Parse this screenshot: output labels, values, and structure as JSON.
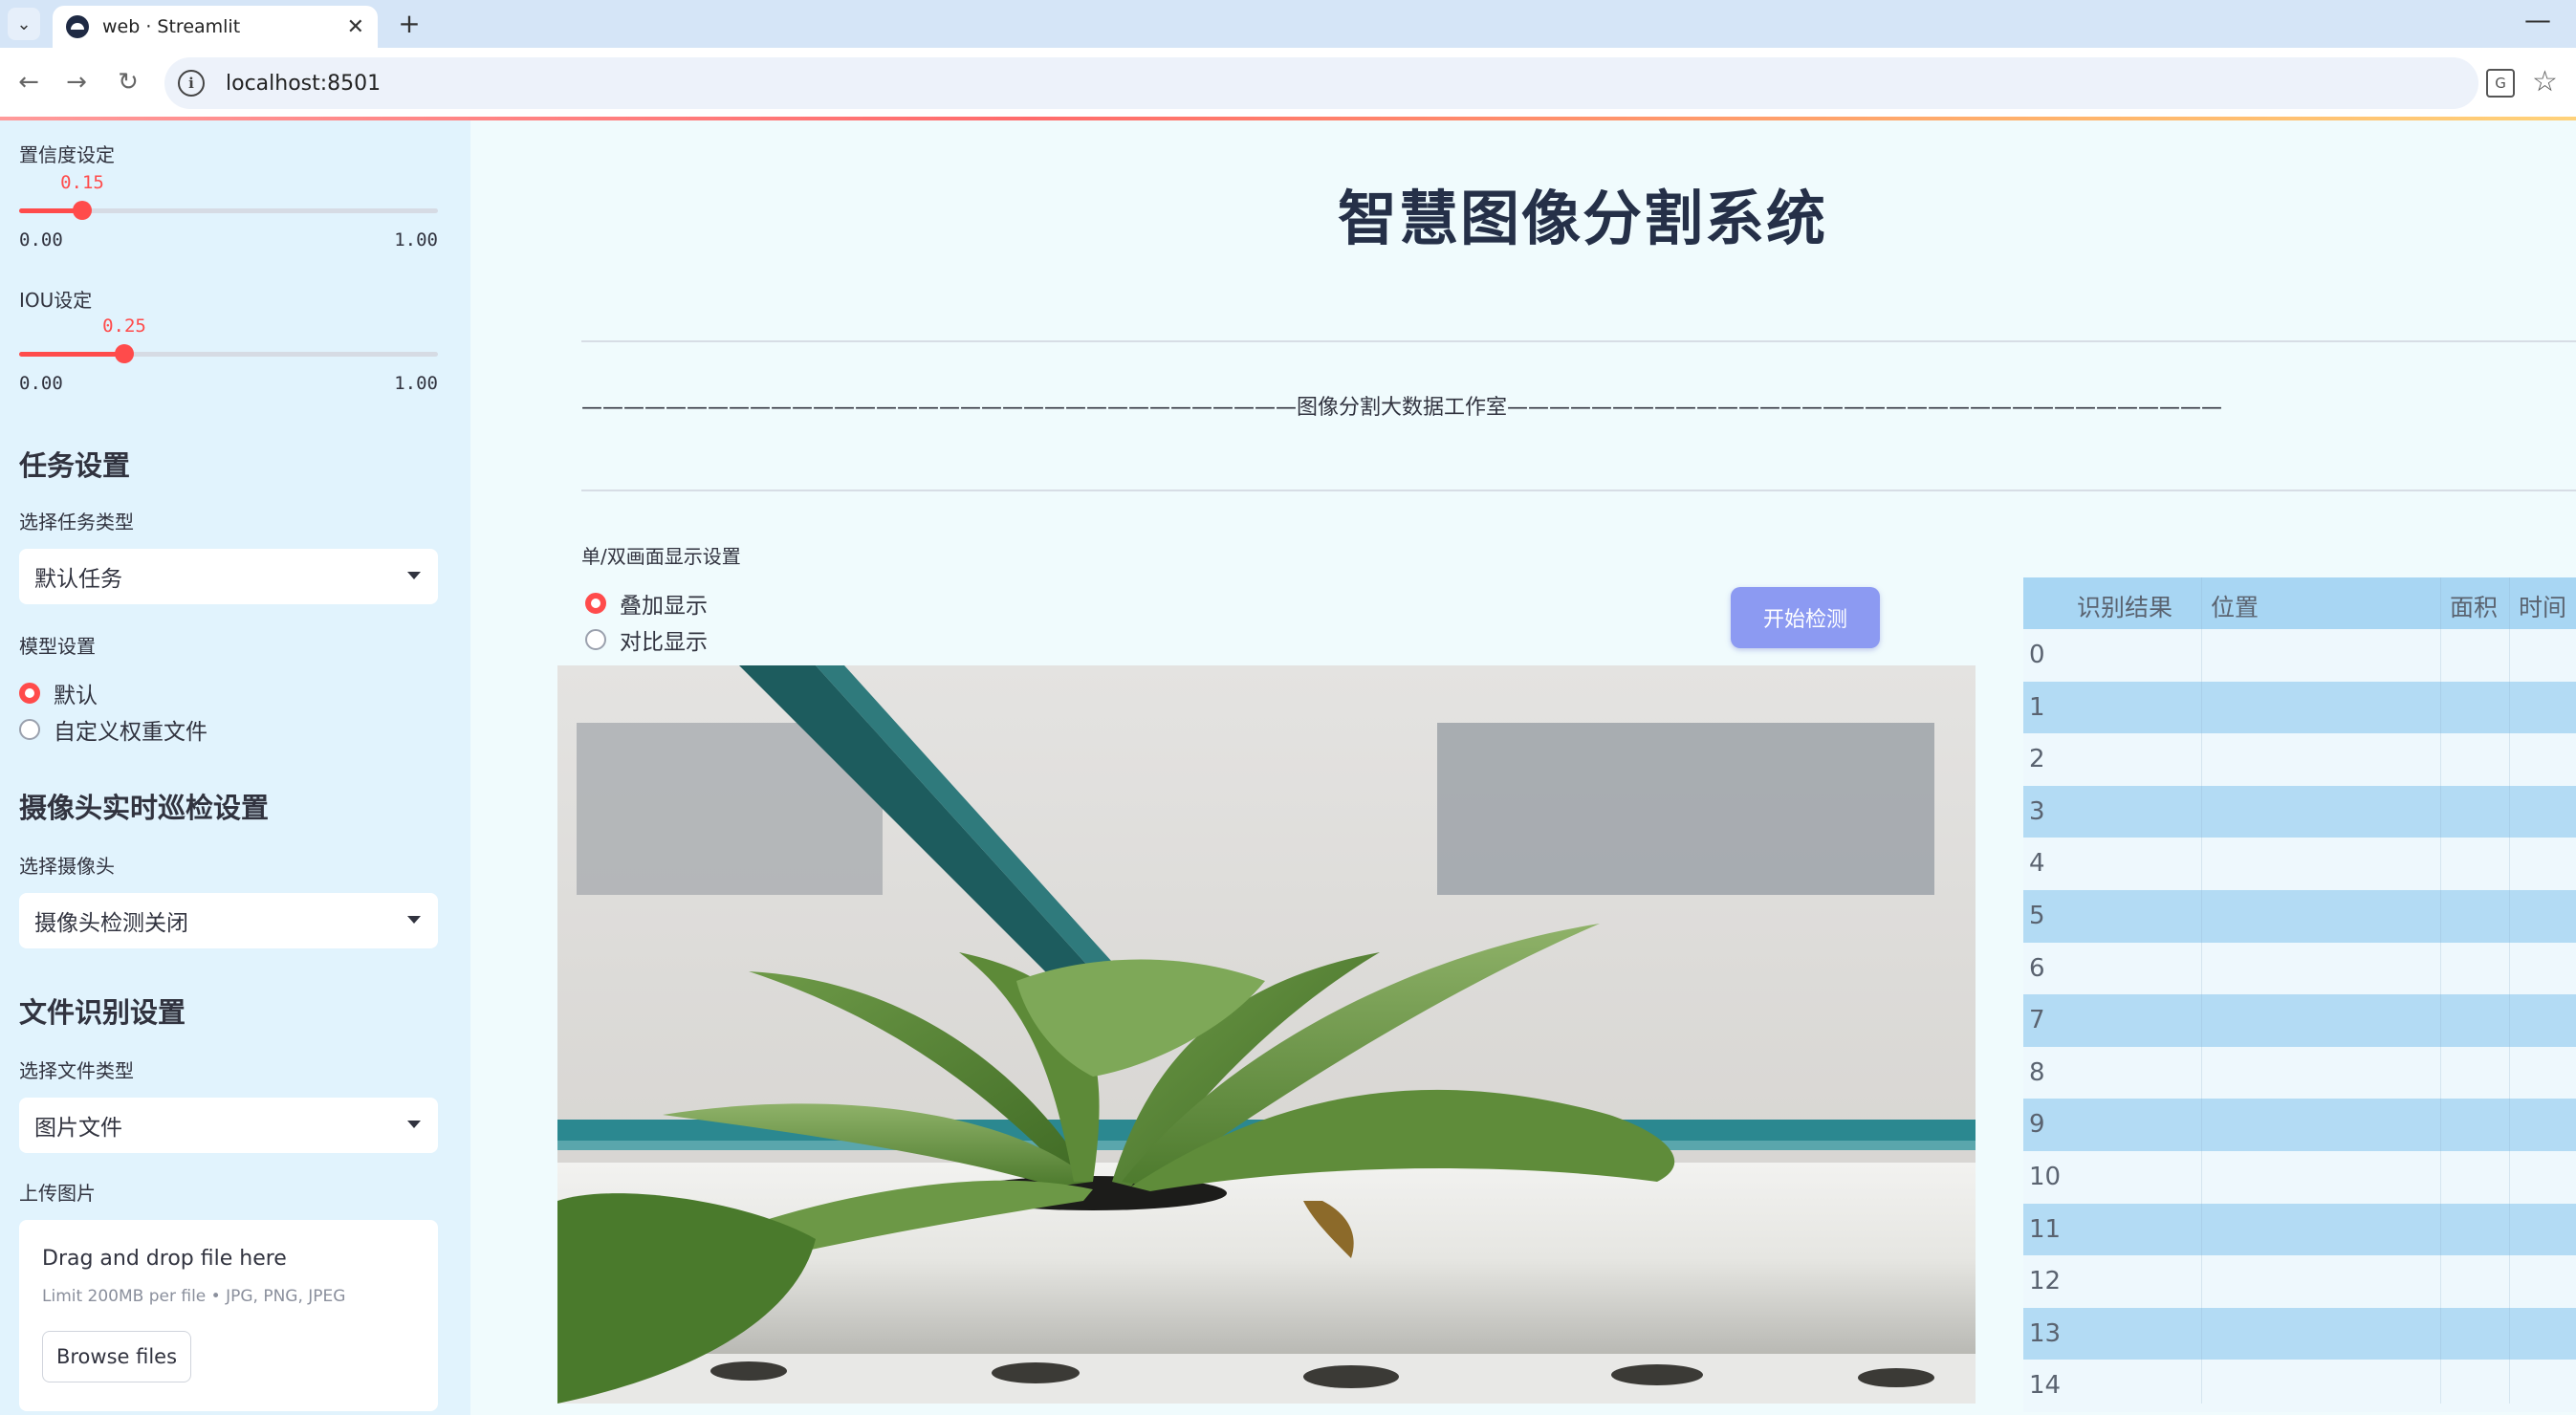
{
  "browser": {
    "tab_title": "web · Streamlit",
    "url": "localhost:8501"
  },
  "sidebar": {
    "confidence": {
      "label": "置信度设定",
      "value": "0.15",
      "min": "0.00",
      "max": "1.00",
      "fraction": 0.15
    },
    "iou": {
      "label": "IOU设定",
      "value": "0.25",
      "min": "0.00",
      "max": "1.00",
      "fraction": 0.25
    },
    "task_heading": "任务设置",
    "task_type_label": "选择任务类型",
    "task_type_value": "默认任务",
    "model_label": "模型设置",
    "model_options": [
      "默认",
      "自定义权重文件"
    ],
    "camera_heading": "摄像头实时巡检设置",
    "camera_label": "选择摄像头",
    "camera_value": "摄像头检测关闭",
    "file_heading": "文件识别设置",
    "file_type_label": "选择文件类型",
    "file_type_value": "图片文件",
    "upload_label": "上传图片",
    "upload_title": "Drag and drop file here",
    "upload_limit": "Limit 200MB per file • JPG, PNG, JPEG",
    "browse_button": "Browse files"
  },
  "main": {
    "title": "智慧图像分割系统",
    "banner": "——————————————————————————————————图像分割大数据工作室——————————————————————————————————",
    "display_label": "单/双画面显示设置",
    "display_options": [
      "叠加显示",
      "对比显示"
    ],
    "start_button": "开始检测"
  },
  "table": {
    "columns": [
      "识别结果",
      "位置",
      "面积",
      "时间"
    ],
    "rows": [
      "0",
      "1",
      "2",
      "3",
      "4",
      "5",
      "6",
      "7",
      "8",
      "9",
      "10",
      "11",
      "12",
      "13",
      "14"
    ]
  },
  "colors": {
    "accent": "#ff4b4b",
    "button": "#8c9af2",
    "sidebar": "#e1f3fd",
    "table_header": "#a8d6f3"
  }
}
